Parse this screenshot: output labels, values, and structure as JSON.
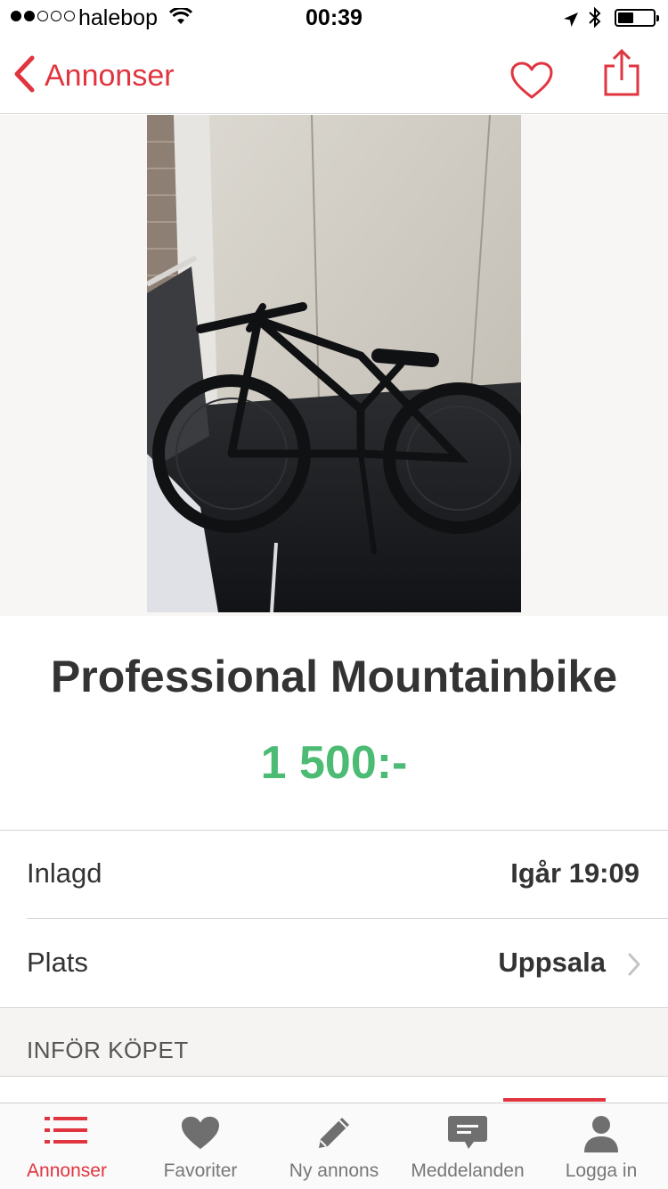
{
  "status_bar": {
    "carrier": "halebop",
    "time": "00:39",
    "battery_level": 0.45
  },
  "nav": {
    "back_label": "Annonser"
  },
  "listing": {
    "title": "Professional Mountainbike",
    "price": "1 500:-",
    "details": [
      {
        "key": "Inlagd",
        "value": "Igår 19:09"
      },
      {
        "key": "Plats",
        "value": "Uppsala"
      }
    ],
    "section_header": "INFÖR KÖPET"
  },
  "tabs": [
    {
      "label": "Annonser",
      "icon": "list-icon",
      "active": true
    },
    {
      "label": "Favoriter",
      "icon": "heart-icon",
      "active": false
    },
    {
      "label": "Ny annons",
      "icon": "pencil-icon",
      "active": false
    },
    {
      "label": "Meddelanden",
      "icon": "chat-icon",
      "active": false
    },
    {
      "label": "Logga in",
      "icon": "person-icon",
      "active": false
    }
  ],
  "colors": {
    "accent": "#e0353f",
    "price": "#4cbb74"
  }
}
